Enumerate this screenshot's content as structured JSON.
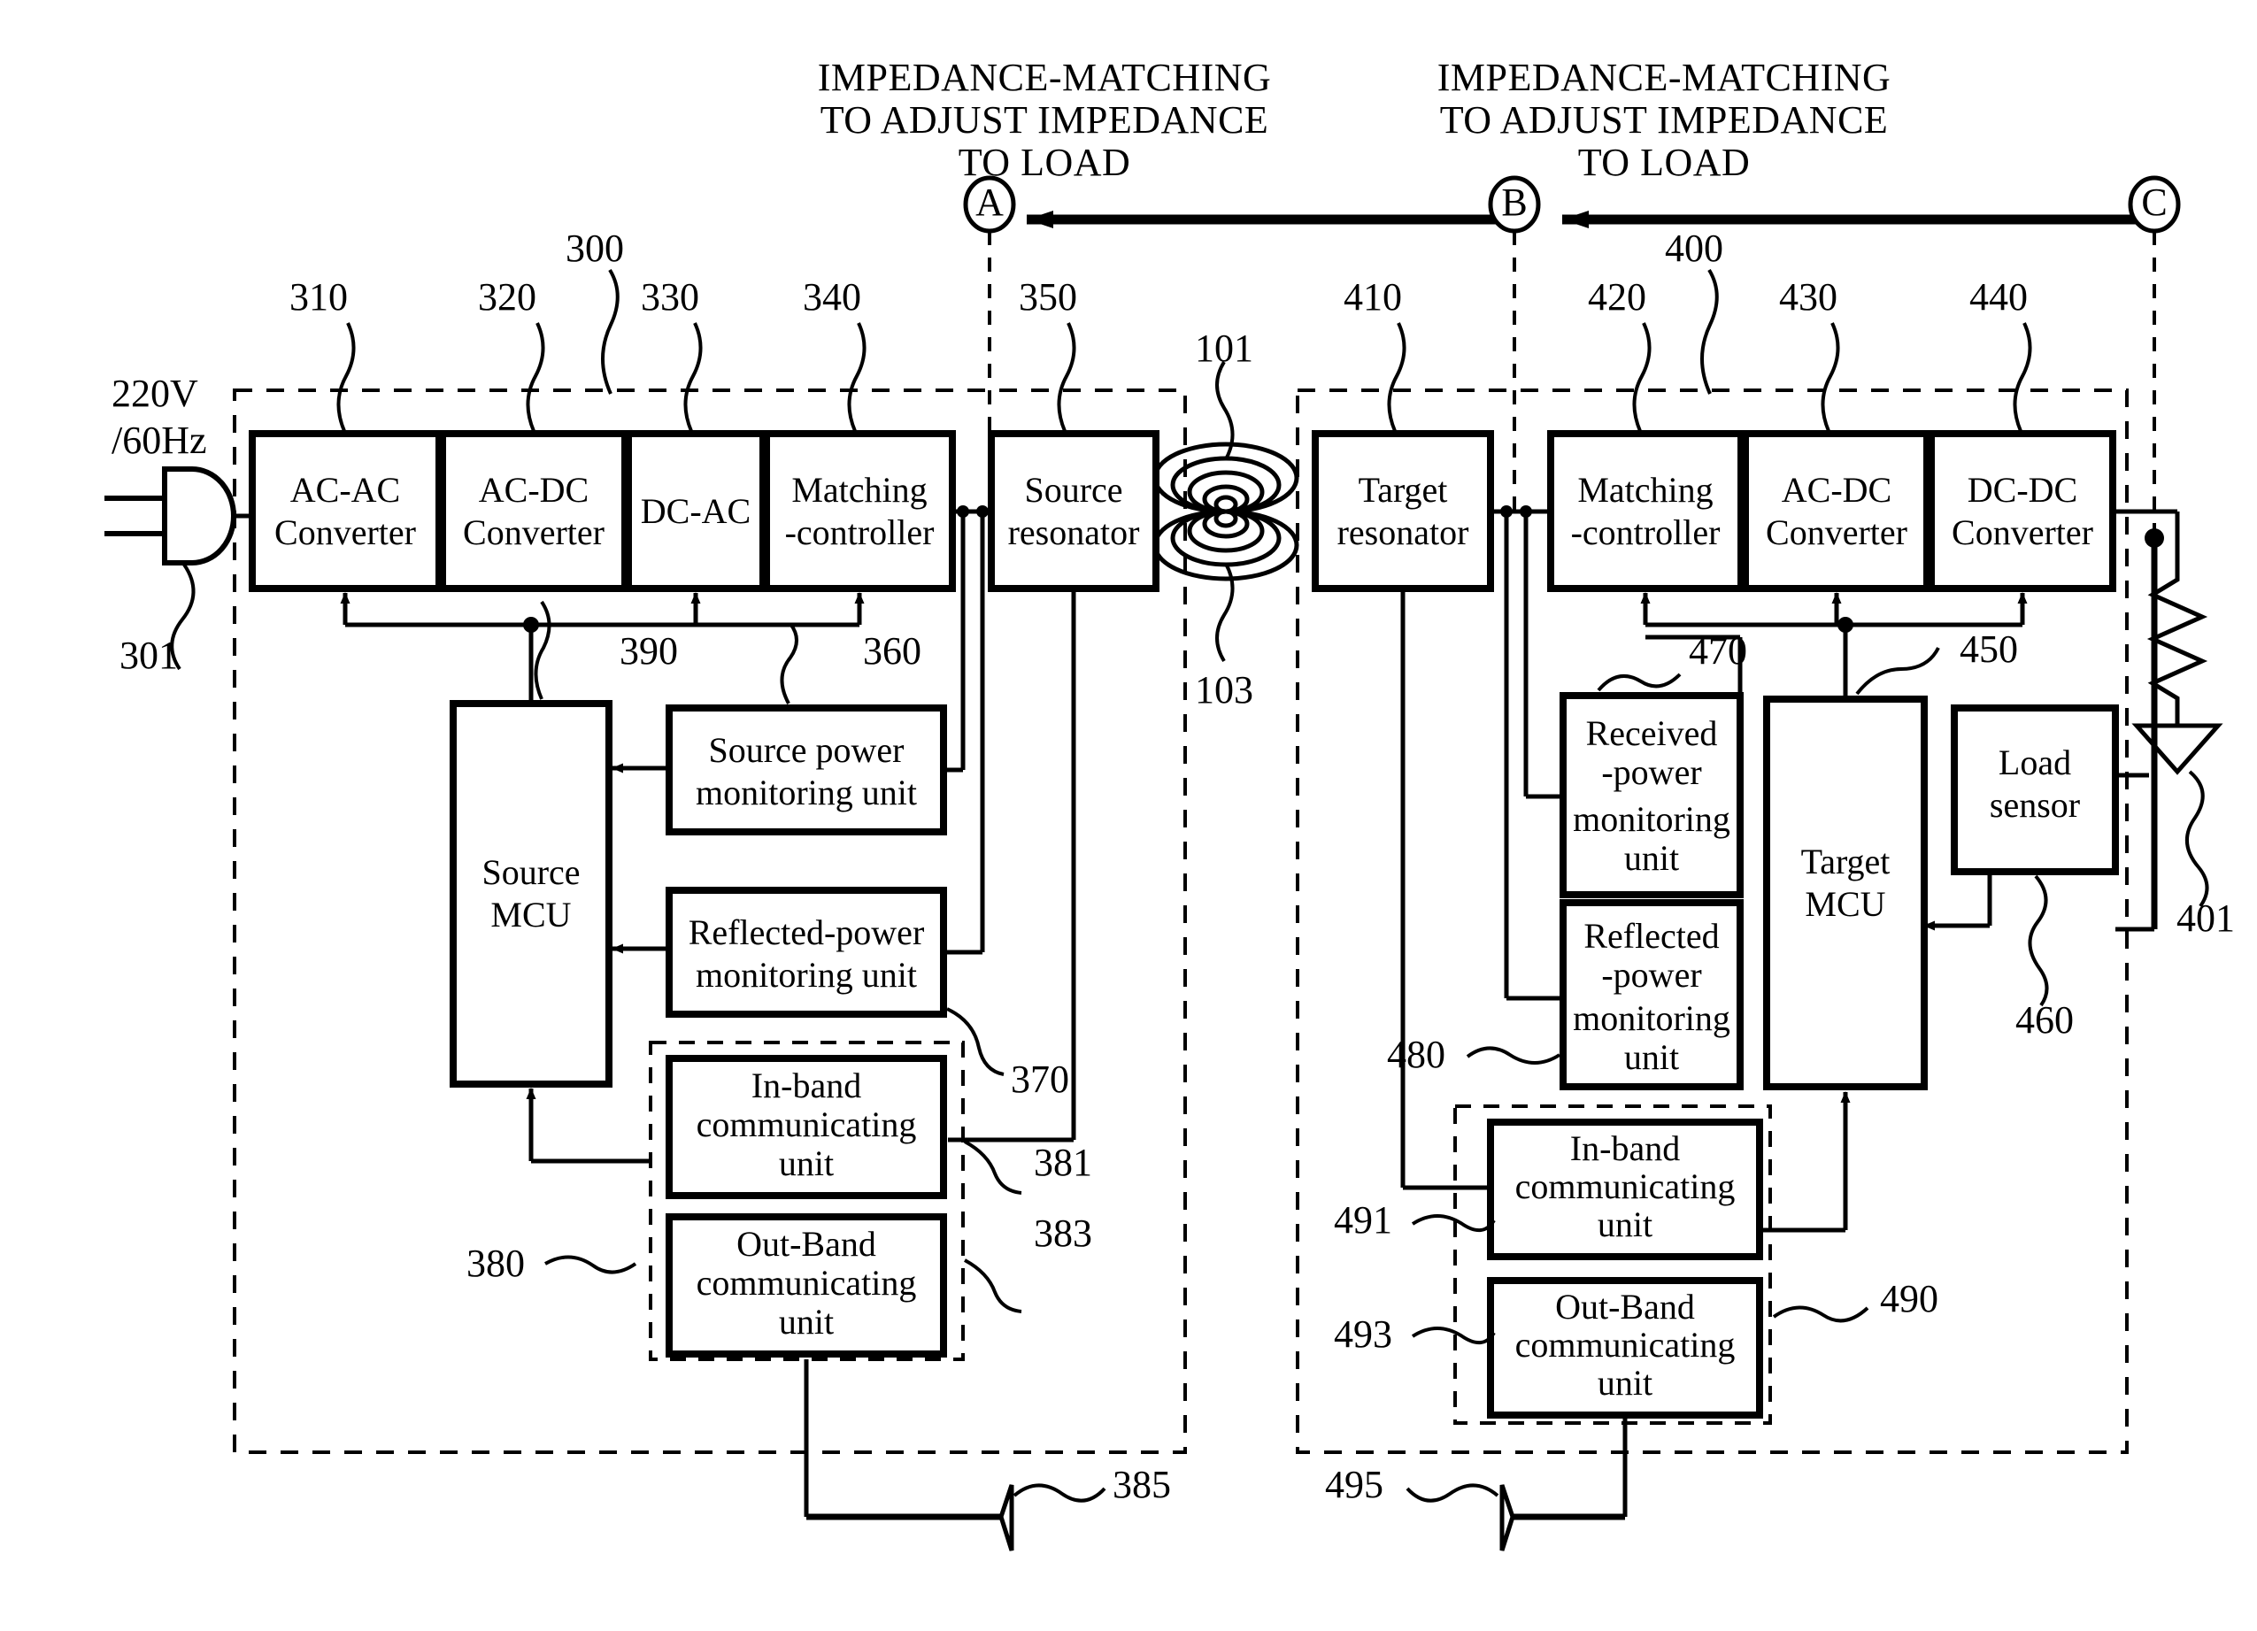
{
  "figure": {
    "type": "patent-block-diagram",
    "title": "Wireless power transmission system block diagram"
  },
  "headers": [
    {
      "id": "header-left",
      "line1": "IMPEDANCE-MATCHING",
      "line2": "TO ADJUST IMPEDANCE",
      "line3": "TO LOAD"
    },
    {
      "id": "header-right",
      "line1": "IMPEDANCE-MATCHING",
      "line2": "TO ADJUST IMPEDANCE",
      "line3": "TO LOAD"
    }
  ],
  "nodes": [
    {
      "id": "node-a",
      "label": "A"
    },
    {
      "id": "node-b",
      "label": "B"
    },
    {
      "id": "node-c",
      "label": "C"
    }
  ],
  "power_source": {
    "line1": "220V",
    "line2": "/60Hz",
    "ref": "301"
  },
  "source_side": {
    "group_ref": "300",
    "blocks": [
      {
        "ref": "310",
        "line1": "AC-AC",
        "line2": "Converter"
      },
      {
        "ref": "320",
        "line1": "AC-DC",
        "line2": "Converter"
      },
      {
        "ref": "330",
        "line1": "DC-AC",
        "line2": ""
      },
      {
        "ref": "340",
        "line1": "Matching",
        "line2": "-controller"
      },
      {
        "ref": "350",
        "line1": "Source",
        "line2": "resonator"
      },
      {
        "ref": "390",
        "line1": "Source",
        "line2": "MCU"
      },
      {
        "ref": "360",
        "line1": "Source power",
        "line2": "monitoring unit"
      },
      {
        "ref": "370",
        "line1": "Reflected-power",
        "line2": "monitoring unit"
      },
      {
        "ref": "381",
        "line1": "In-band",
        "line2": "communicating",
        "line3": "unit"
      },
      {
        "ref": "383",
        "line1": "Out-Band",
        "line2": "communicating",
        "line3": "unit"
      }
    ],
    "comm_group_ref": "380",
    "antenna_ref": "385"
  },
  "coupling": {
    "ref_top": "101",
    "ref_bottom": "103"
  },
  "target_side": {
    "group_ref": "400",
    "blocks": [
      {
        "ref": "410",
        "line1": "Target",
        "line2": "resonator"
      },
      {
        "ref": "420",
        "line1": "Matching",
        "line2": "-controller"
      },
      {
        "ref": "430",
        "line1": "AC-DC",
        "line2": "Converter"
      },
      {
        "ref": "440",
        "line1": "DC-DC",
        "line2": "Converter"
      },
      {
        "ref": "470",
        "line1": "Received",
        "line2": "-power",
        "line3": "monitoring",
        "line4": "unit"
      },
      {
        "ref": "480",
        "line1": "Reflected",
        "line2": "-power",
        "line3": "monitoring",
        "line4": "unit"
      },
      {
        "ref": "450",
        "line1": "Target",
        "line2": "MCU"
      },
      {
        "ref": "460",
        "line1": "Load",
        "line2": "sensor"
      },
      {
        "ref": "491",
        "line1": "In-band",
        "line2": "communicating",
        "line3": "unit"
      },
      {
        "ref": "493",
        "line1": "Out-Band",
        "line2": "communicating",
        "line3": "unit"
      }
    ],
    "comm_group_ref": "490",
    "antenna_ref": "495",
    "load_ref": "401"
  }
}
